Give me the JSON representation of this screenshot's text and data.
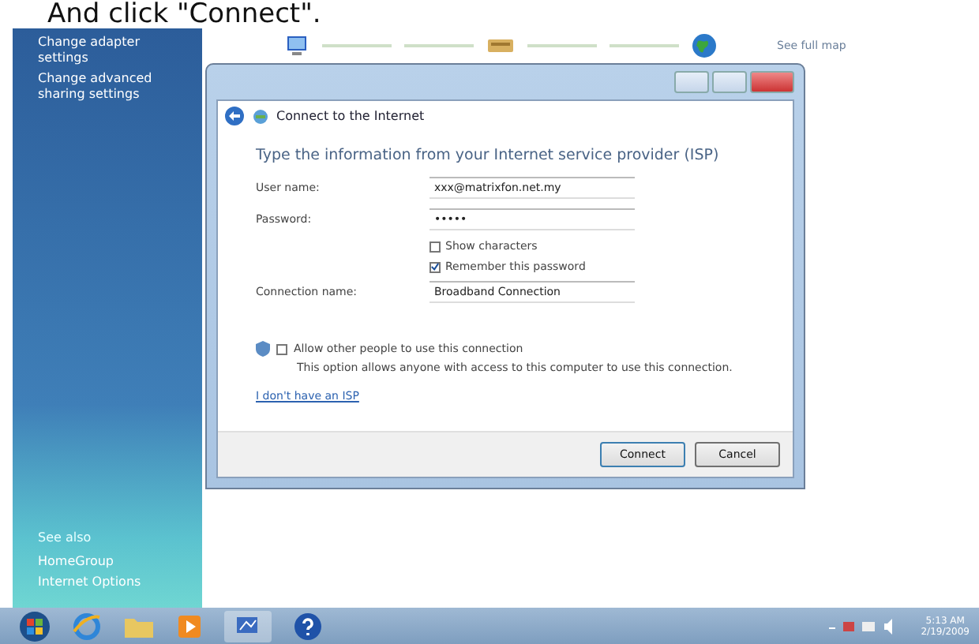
{
  "caption": "And click \"Connect\".",
  "sidebar": {
    "top_links": [
      "Change adapter settings",
      "Change advanced sharing settings"
    ],
    "see_also_heading": "See also",
    "see_also_links": [
      "HomeGroup",
      "Internet Options"
    ]
  },
  "network_map": {
    "link": "See full map"
  },
  "dialog": {
    "title": "Connect to the Internet",
    "heading": "Type the information from your Internet service provider (ISP)",
    "fields": [
      {
        "label": "User name:",
        "value": "xxx@matrixfon.net.my"
      },
      {
        "label": "Password:",
        "value": "•••••"
      }
    ],
    "options": [
      {
        "label": "Show characters",
        "checked": false
      },
      {
        "label": "Remember this password",
        "checked": true
      }
    ],
    "connection_name": {
      "label": "Connection name:",
      "value": "Broadband Connection"
    },
    "allow_others": {
      "label": "Allow other people to use this connection",
      "checked": false,
      "description": "This option allows anyone with access to this computer to use this connection."
    },
    "link": "I don't have an ISP",
    "buttons": [
      "Connect",
      "Cancel"
    ]
  },
  "taskbar": {
    "time": "5:13 AM",
    "date": "2/19/2009"
  }
}
